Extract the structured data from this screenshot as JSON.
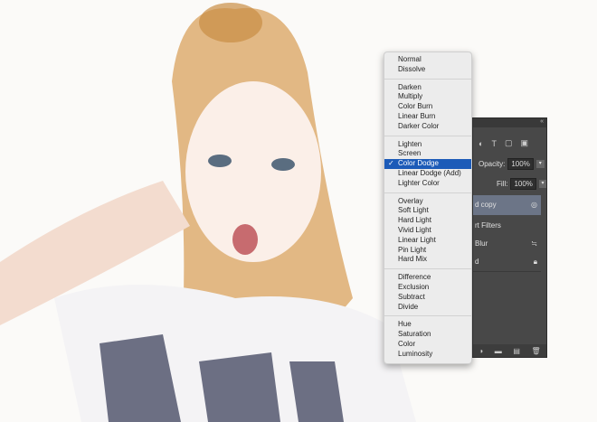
{
  "blend_menu": {
    "groups": [
      [
        "Normal",
        "Dissolve"
      ],
      [
        "Darken",
        "Multiply",
        "Color Burn",
        "Linear Burn",
        "Darker Color"
      ],
      [
        "Lighten",
        "Screen",
        "Color Dodge",
        "Linear Dodge (Add)",
        "Lighter Color"
      ],
      [
        "Overlay",
        "Soft Light",
        "Hard Light",
        "Vivid Light",
        "Linear Light",
        "Pin Light",
        "Hard Mix"
      ],
      [
        "Difference",
        "Exclusion",
        "Subtract",
        "Divide"
      ],
      [
        "Hue",
        "Saturation",
        "Color",
        "Luminosity"
      ]
    ],
    "selected": "Color Dodge",
    "check": "✓",
    "accent": "#1c5bb8"
  },
  "layers_panel": {
    "collapse": "«",
    "opacity_label": "Opacity:",
    "opacity_value": "100%",
    "fill_label": "Fill:",
    "fill_value": "100%",
    "layers": [
      {
        "name": "d copy",
        "selected": true
      },
      {
        "name": "rt Filters"
      },
      {
        "name": "Blur"
      },
      {
        "name": "d"
      }
    ]
  }
}
